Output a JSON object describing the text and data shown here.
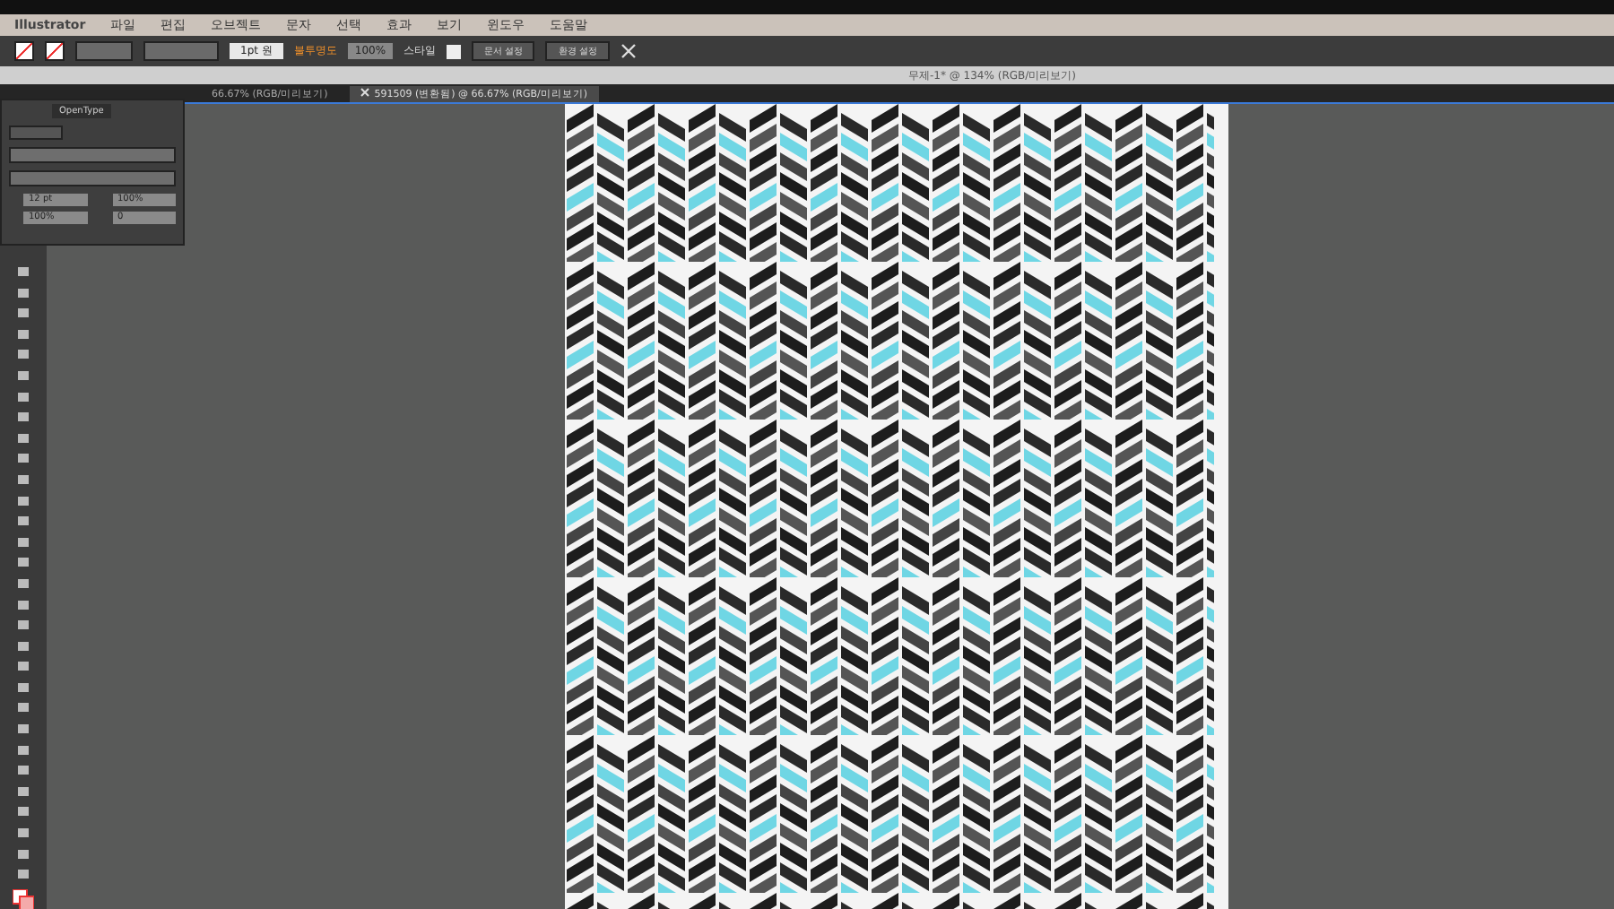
{
  "menu_bar": {
    "app_name": "Illustrator",
    "items": [
      "파일",
      "편집",
      "오브젝트",
      "문자",
      "선택",
      "효과",
      "보기",
      "윈도우",
      "도움말"
    ]
  },
  "control_bar": {
    "stroke_profile": "1pt 원",
    "opacity_label": "불투명도",
    "opacity": "100%",
    "style_label": "스타일",
    "buttons": [
      "문서 설정",
      "환경 설정"
    ]
  },
  "window": {
    "title": "무제-1* @ 134% (RGB/미리보기)"
  },
  "tabs": [
    {
      "label": "66.67% (RGB/미리보기)",
      "selected": false
    },
    {
      "label": "591509 (변환됨) @ 66.67% (RGB/미리보기)",
      "selected": true
    }
  ],
  "character_panel": {
    "tab": "OpenType",
    "fields": [
      "12 pt",
      "100%",
      "100%",
      "0"
    ]
  }
}
